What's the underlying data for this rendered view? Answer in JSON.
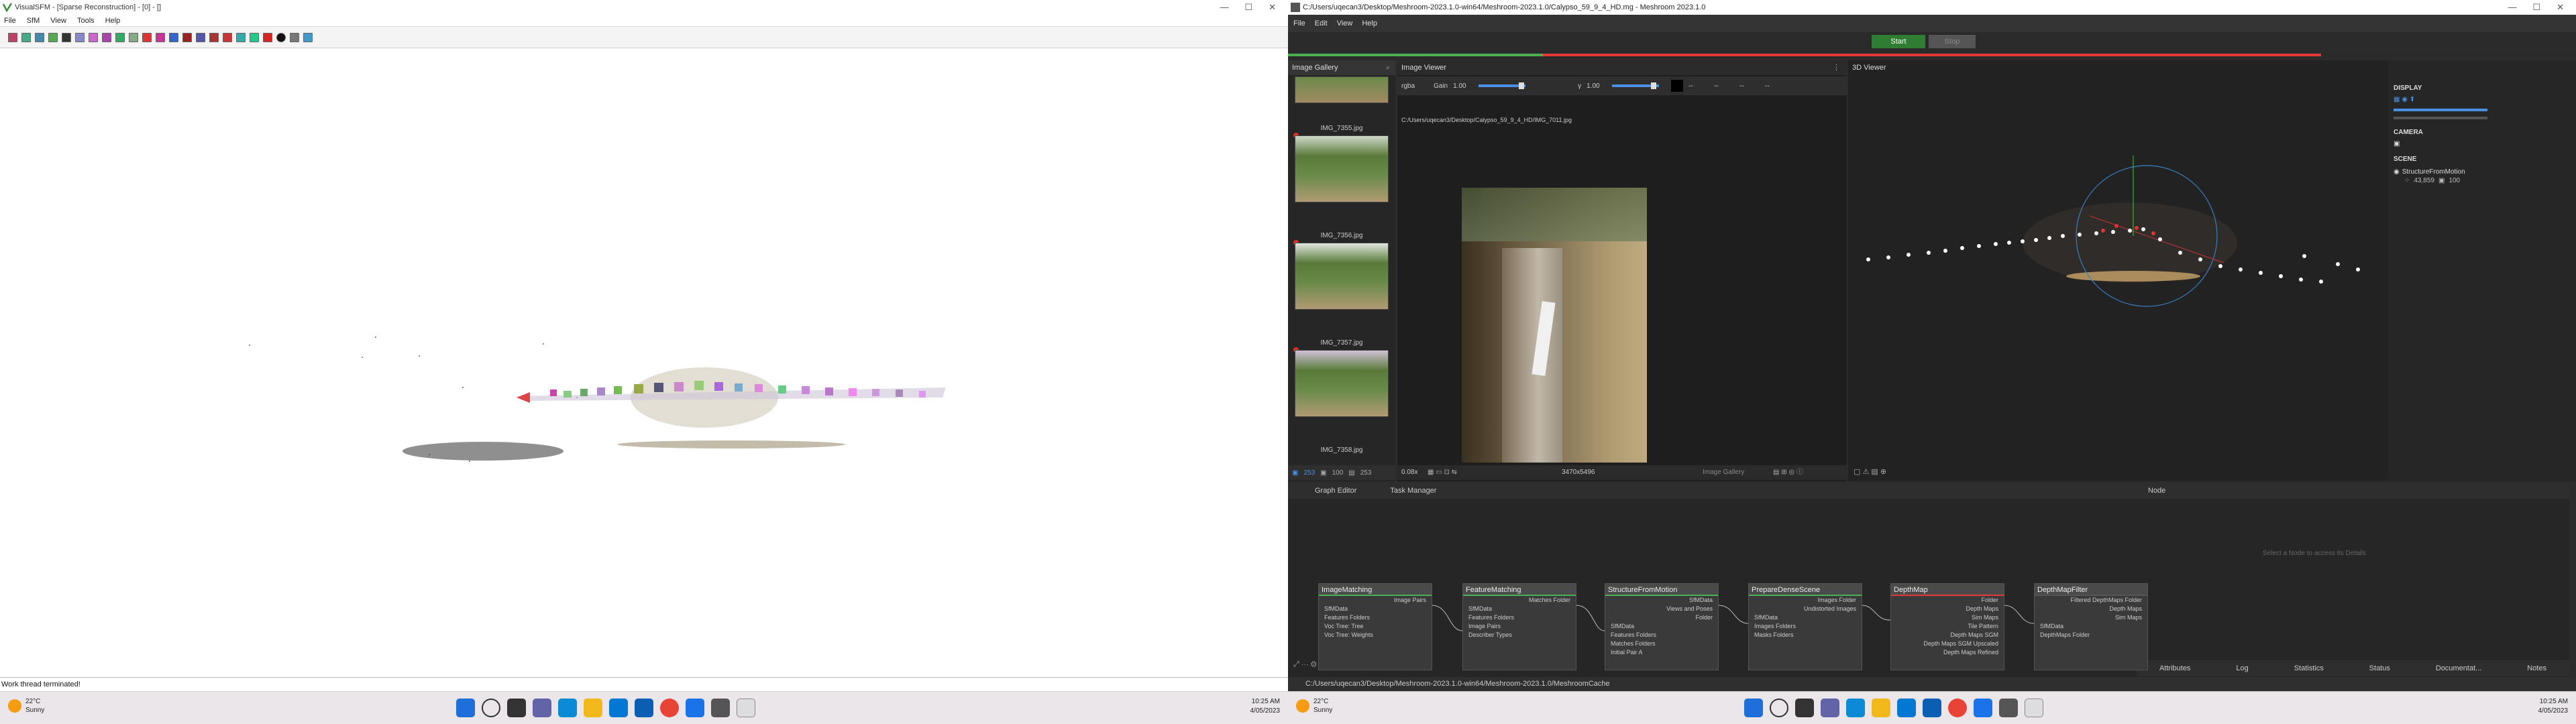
{
  "vsfm": {
    "title": "VisualSFM - [Sparse Reconstruction] - [0] - []",
    "menu": [
      "File",
      "SfM",
      "View",
      "Tools",
      "Help"
    ],
    "status": "Work thread terminated!"
  },
  "meshroom": {
    "title": "C:/Users/uqecan3/Desktop/Meshroom-2023.1.0-win64/Meshroom-2023.1.0/Calypso_59_9_4_HD.mg - Meshroom 2023.1.0",
    "menu": [
      "File",
      "Edit",
      "View",
      "Help"
    ],
    "start": "Start",
    "stop": "Stop",
    "gallery": {
      "header": "Image Gallery",
      "items": [
        {
          "label": "IMG_7355.jpg"
        },
        {
          "label": "IMG_7356.jpg"
        },
        {
          "label": "IMG_7357.jpg"
        },
        {
          "label": "IMG_7358.jpg"
        }
      ],
      "footer": {
        "count_a": "253",
        "count_b": "100",
        "count_c": "253"
      }
    },
    "viewer": {
      "header": "Image Viewer",
      "mode": "rgba",
      "gain_label": "Gain",
      "gain_value": "1.00",
      "gamma_label": "γ",
      "gamma_value": "1.00",
      "dashes": [
        "--",
        "--",
        "--",
        "--"
      ],
      "path": "C:/Users/uqecan3/Desktop/Calypso_59_9_4_HD/IMG_7011.jpg",
      "zoom": "0.08x",
      "resolution": "3470x5496",
      "source": "Image Gallery"
    },
    "viewer3d": {
      "header": "3D Viewer",
      "display": "DISPLAY",
      "camera": "CAMERA",
      "scene": "SCENE",
      "scene_item": "StructureFromMotion",
      "scene_pts": "43,859",
      "scene_cams": "100"
    },
    "graph": {
      "tabs": [
        "Graph Editor",
        "Task Manager"
      ],
      "node_header": "Node",
      "empty_hint": "Select a Node to access its Details",
      "bottom_tabs": [
        "Attributes",
        "Log",
        "Statistics",
        "Status",
        "Documentat...",
        "Notes"
      ],
      "nodes": [
        {
          "name": "ImageMatching",
          "outputs": [
            "Image Pairs"
          ],
          "inputs": [
            "SfMData",
            "Features Folders",
            "Voc Tree: Tree",
            "Voc Tree: Weights"
          ]
        },
        {
          "name": "FeatureMatching",
          "outputs": [
            "Matches Folder"
          ],
          "inputs": [
            "SfMData",
            "Features Folders",
            "Image Pairs",
            "Describer Types"
          ]
        },
        {
          "name": "StructureFromMotion",
          "outputs": [
            "SfMData",
            "Views and Poses",
            "Folder"
          ],
          "inputs": [
            "SfMData",
            "Features Folders",
            "Matches Folders",
            "Initial Pair A"
          ]
        },
        {
          "name": "PrepareDenseScene",
          "outputs": [
            "Images Folder",
            "Undistorted Images"
          ],
          "inputs": [
            "SfMData",
            "Images Folders",
            "Masks Folders"
          ]
        },
        {
          "name": "DepthMap",
          "outputs": [
            "Folder",
            "Depth Maps",
            "Sim Maps",
            "Tile Pattern",
            "Depth Maps SGM",
            "Depth Maps SGM Upscaled",
            "Depth Maps Refined"
          ],
          "inputs": []
        },
        {
          "name": "DepthMapFilter",
          "outputs": [
            "Filtered DepthMaps Folder",
            "Depth Maps",
            "Sim Maps"
          ],
          "inputs": [
            "SfMData",
            "DepthMaps Folder"
          ]
        }
      ]
    },
    "status_path": "C:/Users/uqecan3/Desktop/Meshroom-2023.1.0-win64/Meshroom-2023.1.0/MeshroomCache"
  },
  "taskbars": [
    {
      "temp": "22°C",
      "weather": "Sunny",
      "time": "10:25 AM",
      "date": "4/05/2023"
    },
    {
      "temp": "22°C",
      "weather": "Sunny",
      "time": "10:25 AM",
      "date": "4/05/2023"
    }
  ],
  "colors": {
    "accent_green": "#4caf50",
    "accent_red": "#e53935",
    "start_green": "#2e7d32"
  }
}
